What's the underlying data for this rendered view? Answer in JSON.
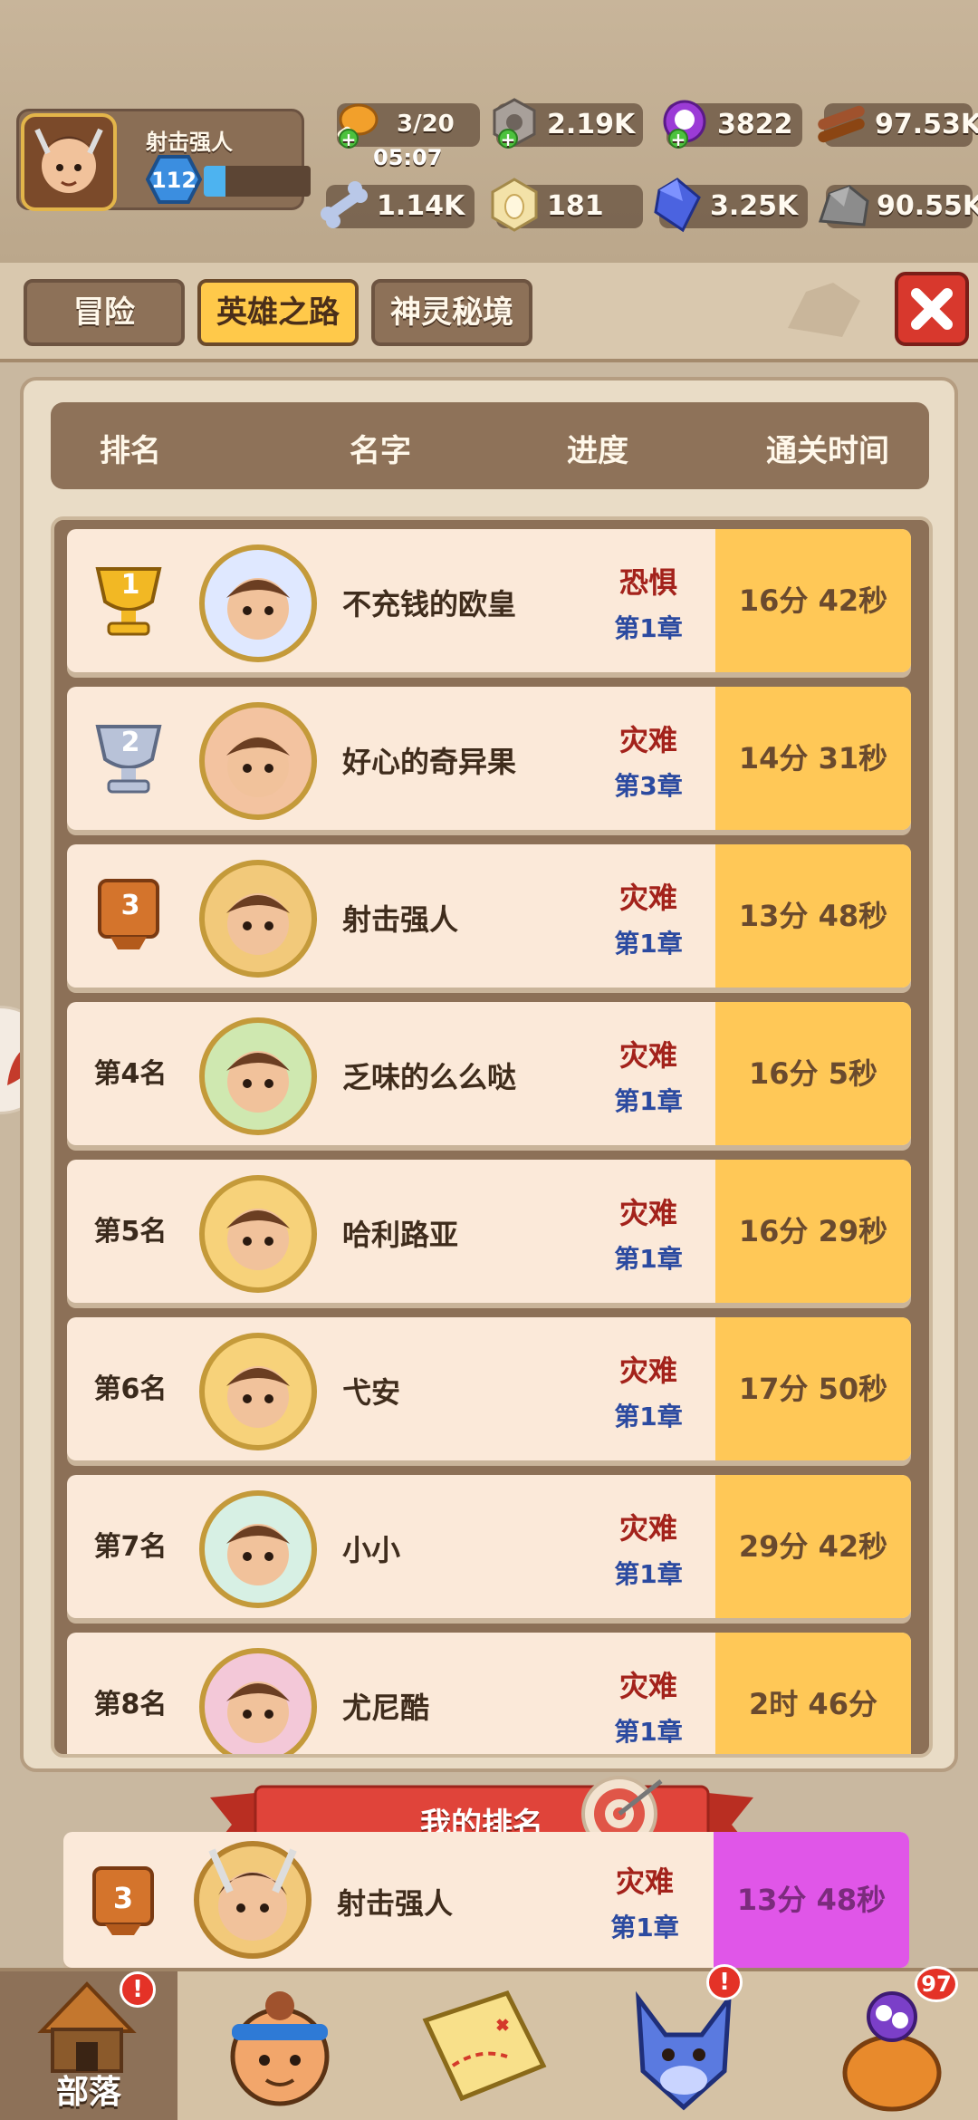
{
  "player": {
    "name": "射击强人",
    "level": "112",
    "level_progress": 0.2
  },
  "resources": {
    "stamina": "3/20",
    "stamina_timer": "05:07",
    "nut": "2.19K",
    "orb": "3822",
    "wood": "97.53K",
    "bone": "1.14K",
    "egg": "181",
    "gem": "3.25K",
    "stone": "90.55K"
  },
  "tabs": [
    "冒险",
    "英雄之路",
    "神灵秘境"
  ],
  "header": {
    "rank": "排名",
    "name": "名字",
    "progress": "进度",
    "time": "通关时间"
  },
  "rows": [
    {
      "rank": "1",
      "name": "不充钱的欧皇",
      "difficulty": "恐惧",
      "chapter": "第1章",
      "time": "16分 42秒"
    },
    {
      "rank": "2",
      "name": "好心的奇异果",
      "difficulty": "灾难",
      "chapter": "第3章",
      "time": "14分 31秒"
    },
    {
      "rank": "3",
      "name": "射击强人",
      "difficulty": "灾难",
      "chapter": "第1章",
      "time": "13分 48秒"
    },
    {
      "rank": "第4名",
      "name": "乏味的么么哒",
      "difficulty": "灾难",
      "chapter": "第1章",
      "time": "16分 5秒"
    },
    {
      "rank": "第5名",
      "name": "哈利路亚",
      "difficulty": "灾难",
      "chapter": "第1章",
      "time": "16分 29秒"
    },
    {
      "rank": "第6名",
      "name": "弋安",
      "difficulty": "灾难",
      "chapter": "第1章",
      "time": "17分 50秒"
    },
    {
      "rank": "第7名",
      "name": "小小",
      "difficulty": "灾难",
      "chapter": "第1章",
      "time": "29分 42秒"
    },
    {
      "rank": "第8名",
      "name": "尤尼酷",
      "difficulty": "灾难",
      "chapter": "第1章",
      "time": "2时 46分"
    }
  ],
  "my_rank": {
    "banner": "我的排名",
    "rank": "3",
    "name": "射击强人",
    "difficulty": "灾难",
    "chapter": "第1章",
    "time": "13分 48秒"
  },
  "nav": {
    "tribe_label": "部落",
    "bag_badge": "97",
    "alert_badge": "!"
  },
  "colors": {
    "gold_time": "#ffc857",
    "my_time": "#e056e8",
    "difficulty": "#a3221b",
    "chapter": "#2b4aa0"
  }
}
